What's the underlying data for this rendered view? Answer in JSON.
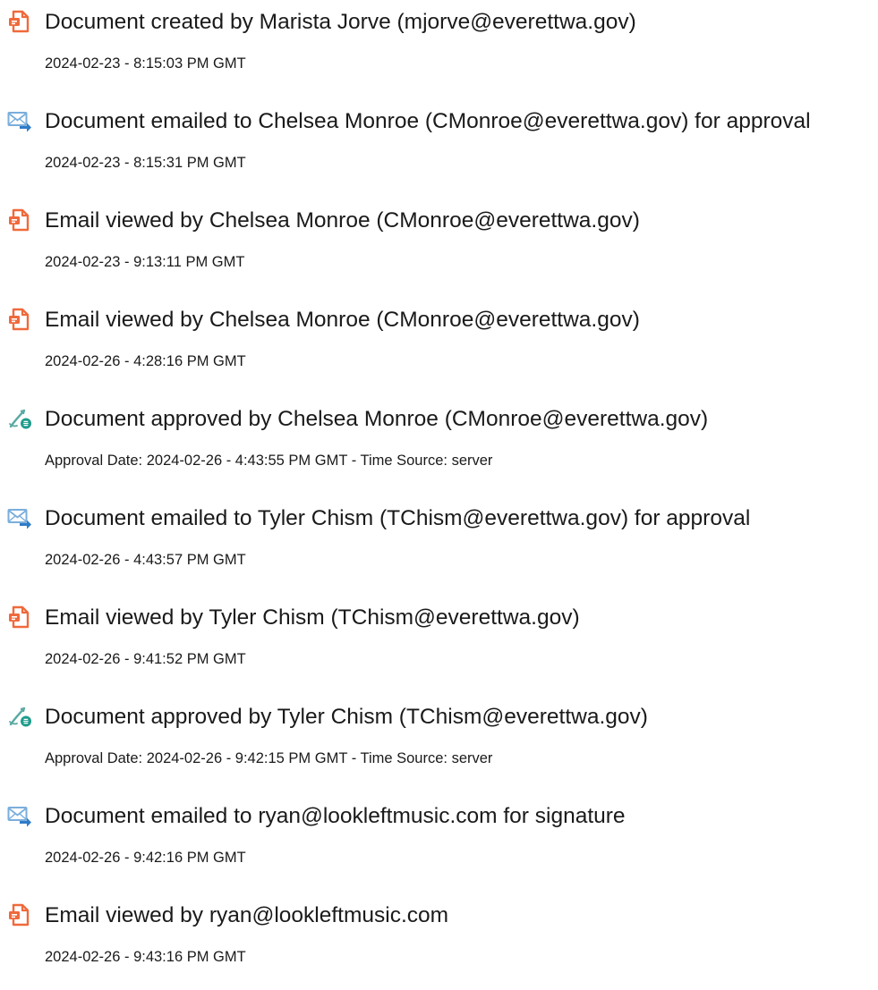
{
  "colors": {
    "text": "#1a1a1a",
    "doc_icon": "#ef6a3c",
    "mail_icon_body": "#7aaedc",
    "mail_icon_arrow": "#2f7cc7",
    "approve_icon": "#5aa9a3",
    "approve_badge": "#1f9c8c"
  },
  "events": [
    {
      "icon": "document-icon",
      "title": "Document created by Marista Jorve (mjorve@everettwa.gov)",
      "subtitle": "2024-02-23 - 8:15:03 PM GMT"
    },
    {
      "icon": "email-sent-icon",
      "title": "Document emailed to Chelsea Monroe (CMonroe@everettwa.gov) for approval",
      "subtitle": "2024-02-23 - 8:15:31 PM GMT"
    },
    {
      "icon": "document-icon",
      "title": "Email viewed by Chelsea Monroe (CMonroe@everettwa.gov)",
      "subtitle": "2024-02-23 - 9:13:11 PM GMT"
    },
    {
      "icon": "document-icon",
      "title": "Email viewed by Chelsea Monroe (CMonroe@everettwa.gov)",
      "subtitle": "2024-02-26 - 4:28:16 PM GMT"
    },
    {
      "icon": "approval-pen-icon",
      "title": "Document approved by Chelsea Monroe (CMonroe@everettwa.gov)",
      "subtitle": "Approval Date: 2024-02-26 - 4:43:55 PM GMT - Time Source: server"
    },
    {
      "icon": "email-sent-icon",
      "title": "Document emailed to Tyler Chism (TChism@everettwa.gov) for approval",
      "subtitle": "2024-02-26 - 4:43:57 PM GMT"
    },
    {
      "icon": "document-icon",
      "title": "Email viewed by Tyler Chism (TChism@everettwa.gov)",
      "subtitle": "2024-02-26 - 9:41:52 PM GMT"
    },
    {
      "icon": "approval-pen-icon",
      "title": "Document approved by Tyler Chism (TChism@everettwa.gov)",
      "subtitle": "Approval Date: 2024-02-26 - 9:42:15 PM GMT - Time Source: server"
    },
    {
      "icon": "email-sent-icon",
      "title": "Document emailed to ryan@lookleftmusic.com for signature",
      "subtitle": "2024-02-26 - 9:42:16 PM GMT"
    },
    {
      "icon": "document-icon",
      "title": "Email viewed by ryan@lookleftmusic.com",
      "subtitle": "2024-02-26 - 9:43:16 PM GMT"
    }
  ]
}
